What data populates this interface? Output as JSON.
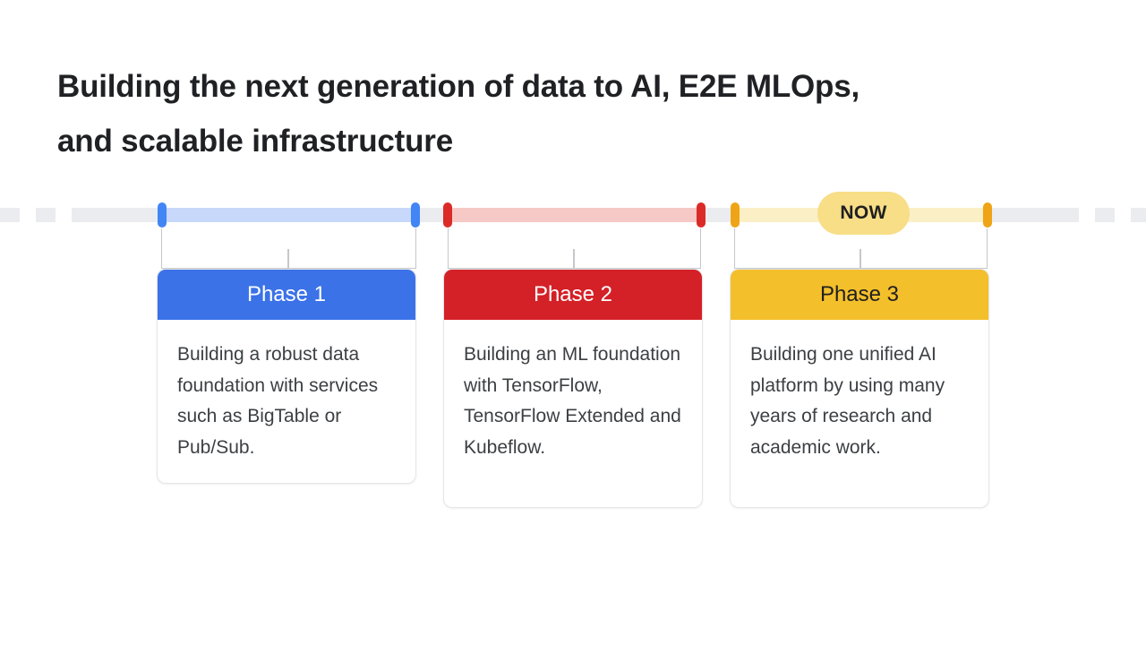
{
  "slide": {
    "title": "Building the next generation of data to AI, E2E MLOps,\nand scalable infrastructure"
  },
  "timeline": {
    "now_badge_label": "NOW",
    "colors": {
      "rail": "#ebecef",
      "phase1_segment": "#c7d8fb",
      "phase1_cap": "#4285f4",
      "phase2_segment": "#f6c8c6",
      "phase2_cap": "#db2b28",
      "phase3_segment": "#fbefc6",
      "phase3_cap": "#efa417",
      "now_badge_bg": "#f7de87"
    }
  },
  "phases": [
    {
      "title": "Phase 1",
      "body": "Building a robust data foundation with services such as BigTable or Pub/Sub.",
      "header_color": "#3b72e8",
      "header_text_color": "#ffffff"
    },
    {
      "title": "Phase 2",
      "body": "Building an ML foundation with TensorFlow, TensorFlow Extended and Kubeflow.",
      "header_color": "#d42027",
      "header_text_color": "#ffffff"
    },
    {
      "title": "Phase 3",
      "body": "Building one unified AI platform by using many years of research and academic work.",
      "header_color": "#f3bf2b",
      "header_text_color": "#1f1f1f"
    }
  ]
}
